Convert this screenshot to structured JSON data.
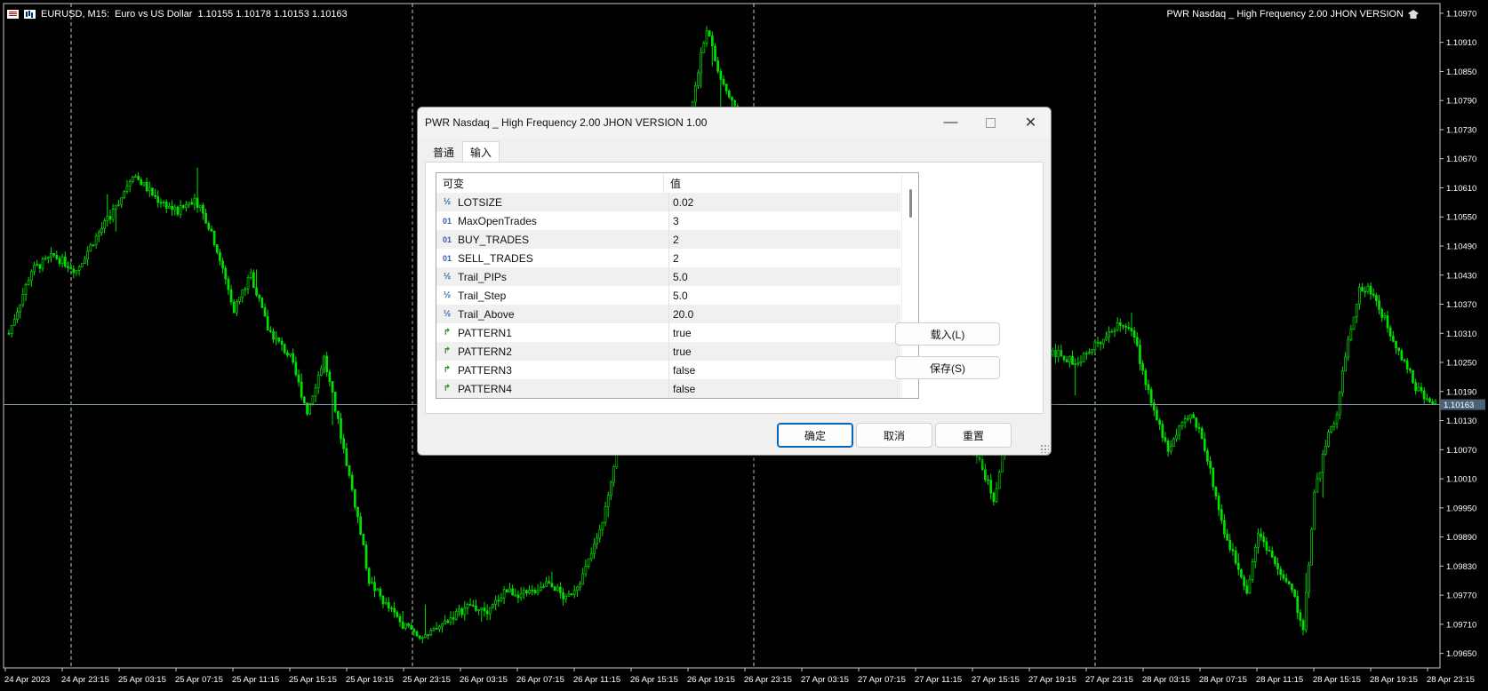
{
  "chart": {
    "symbol": "EURUSD, M15:",
    "description": "Euro vs US Dollar",
    "quote": "1.10155 1.10178 1.10153 1.10163",
    "ea_name": "PWR Nasdaq _ High Frequency 2.00 JHON VERSION",
    "current_price": "1.10163",
    "current_price_value": 1.10163,
    "price_labels": [
      "1.10970",
      "1.10910",
      "1.10850",
      "1.10790",
      "1.10730",
      "1.10670",
      "1.10610",
      "1.10550",
      "1.10490",
      "1.10430",
      "1.10370",
      "1.10310",
      "1.10250",
      "1.10190",
      "1.10130",
      "1.10070",
      "1.10010",
      "1.09950",
      "1.09890",
      "1.09830",
      "1.09770",
      "1.09710",
      "1.09650"
    ],
    "price_min": 1.0962,
    "price_max": 1.1099,
    "time_labels": [
      "24 Apr 2023",
      "24 Apr 23:15",
      "25 Apr 03:15",
      "25 Apr 07:15",
      "25 Apr 11:15",
      "25 Apr 15:15",
      "25 Apr 19:15",
      "25 Apr 23:15",
      "26 Apr 03:15",
      "26 Apr 07:15",
      "26 Apr 11:15",
      "26 Apr 15:15",
      "26 Apr 19:15",
      "26 Apr 23:15",
      "27 Apr 03:15",
      "27 Apr 07:15",
      "27 Apr 11:15",
      "27 Apr 15:15",
      "27 Apr 19:15",
      "27 Apr 23:15",
      "28 Apr 03:15",
      "28 Apr 07:15",
      "28 Apr 11:15",
      "28 Apr 15:15",
      "28 Apr 19:15",
      "28 Apr 23:15"
    ],
    "price_path": [
      [
        0,
        1.1031
      ],
      [
        8,
        1.1044
      ],
      [
        16,
        1.1047
      ],
      [
        24,
        1.1044
      ],
      [
        30,
        1.105
      ],
      [
        38,
        1.1057
      ],
      [
        44,
        1.1064
      ],
      [
        52,
        1.1059
      ],
      [
        60,
        1.1056
      ],
      [
        66,
        1.1059
      ],
      [
        72,
        1.1052
      ],
      [
        80,
        1.1036
      ],
      [
        86,
        1.1043
      ],
      [
        92,
        1.1032
      ],
      [
        100,
        1.1026
      ],
      [
        106,
        1.1015
      ],
      [
        112,
        1.1026
      ],
      [
        118,
        1.101
      ],
      [
        124,
        1.0993
      ],
      [
        128,
        1.098
      ],
      [
        134,
        1.0975
      ],
      [
        140,
        1.0971
      ],
      [
        148,
        1.0968
      ],
      [
        156,
        1.0972
      ],
      [
        164,
        1.0975
      ],
      [
        170,
        1.0973
      ],
      [
        176,
        1.0978
      ],
      [
        184,
        1.0977
      ],
      [
        192,
        1.098
      ],
      [
        198,
        1.0976
      ],
      [
        204,
        1.0981
      ],
      [
        210,
        1.099
      ],
      [
        214,
        1.1
      ],
      [
        220,
        1.1025
      ],
      [
        228,
        1.104
      ],
      [
        236,
        1.1058
      ],
      [
        244,
        1.1082
      ],
      [
        248,
        1.1094
      ],
      [
        252,
        1.1085
      ],
      [
        258,
        1.1077
      ],
      [
        264,
        1.1068
      ],
      [
        272,
        1.106
      ],
      [
        280,
        1.1052
      ],
      [
        290,
        1.1045
      ],
      [
        300,
        1.1038
      ],
      [
        310,
        1.103
      ],
      [
        320,
        1.1022
      ],
      [
        330,
        1.1015
      ],
      [
        340,
        1.101
      ],
      [
        346,
        1.1003
      ],
      [
        350,
        1.0997
      ],
      [
        354,
        1.1008
      ],
      [
        360,
        1.102
      ],
      [
        366,
        1.1028
      ],
      [
        372,
        1.1027
      ],
      [
        378,
        1.1025
      ],
      [
        384,
        1.1027
      ],
      [
        390,
        1.1031
      ],
      [
        396,
        1.1033
      ],
      [
        400,
        1.103
      ],
      [
        404,
        1.1021
      ],
      [
        408,
        1.1013
      ],
      [
        412,
        1.1007
      ],
      [
        416,
        1.1011
      ],
      [
        420,
        1.1014
      ],
      [
        424,
        1.101
      ],
      [
        428,
        1.1
      ],
      [
        432,
        1.099
      ],
      [
        436,
        1.0984
      ],
      [
        440,
        1.0978
      ],
      [
        444,
        1.099
      ],
      [
        448,
        1.0986
      ],
      [
        452,
        1.0981
      ],
      [
        456,
        1.0978
      ],
      [
        460,
        1.097
      ],
      [
        464,
        1.0998
      ],
      [
        468,
        1.1008
      ],
      [
        472,
        1.1015
      ],
      [
        476,
        1.103
      ],
      [
        480,
        1.104
      ],
      [
        484,
        1.104
      ],
      [
        488,
        1.1035
      ],
      [
        492,
        1.103
      ],
      [
        496,
        1.1025
      ],
      [
        500,
        1.102
      ],
      [
        504,
        1.1017
      ],
      [
        508,
        1.1016
      ]
    ]
  },
  "dialog": {
    "title": "PWR Nasdaq _ High Frequency 2.00 JHON VERSION 1.00",
    "tabs": [
      {
        "label": "普通"
      },
      {
        "label": "输入"
      }
    ],
    "columns": {
      "name": "可变",
      "value": "值"
    },
    "params": [
      {
        "name": "LOTSIZE",
        "value": "0.02",
        "type": "double",
        "icon": "½"
      },
      {
        "name": "MaxOpenTrades",
        "value": "3",
        "type": "int",
        "icon": "01"
      },
      {
        "name": "BUY_TRADES",
        "value": "2",
        "type": "int",
        "icon": "01"
      },
      {
        "name": "SELL_TRADES",
        "value": "2",
        "type": "int",
        "icon": "01"
      },
      {
        "name": "Trail_PIPs",
        "value": "5.0",
        "type": "double",
        "icon": "½"
      },
      {
        "name": "Trail_Step",
        "value": "5.0",
        "type": "double",
        "icon": "½"
      },
      {
        "name": "Trail_Above",
        "value": "20.0",
        "type": "double",
        "icon": "½"
      },
      {
        "name": "PATTERN1",
        "value": "true",
        "type": "bool",
        "icon": "↱"
      },
      {
        "name": "PATTERN2",
        "value": "true",
        "type": "bool",
        "icon": "↱"
      },
      {
        "name": "PATTERN3",
        "value": "false",
        "type": "bool",
        "icon": "↱"
      },
      {
        "name": "PATTERN4",
        "value": "false",
        "type": "bool",
        "icon": "↱"
      }
    ],
    "load_label": "载入(L)",
    "save_label": "保存(S)",
    "ok_label": "确定",
    "cancel_label": "取消",
    "reset_label": "重置"
  }
}
